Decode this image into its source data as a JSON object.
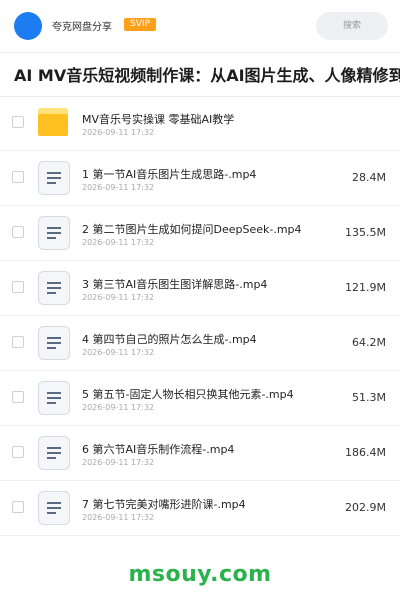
{
  "header": {
    "owner_name": "夸克网盘分享",
    "badge": "SVIP",
    "search_placeholder": "搜索",
    "colors": {
      "avatar": "#1e7cf2",
      "badge": "#ff9f1a"
    }
  },
  "share": {
    "title": "AI MV音乐短视频制作课：从AI图片生成、人像精修到导演"
  },
  "items": [
    {
      "type": "folder",
      "icon": "folder-icon",
      "name": "MV音乐号实操课 零基础AI教学",
      "date": "2026-09-11 17:32",
      "size": ""
    },
    {
      "type": "file",
      "icon": "file-icon",
      "name": "1 第一节AI音乐图片生成思路-.mp4",
      "date": "2026-09-11 17:32",
      "size": "28.4M"
    },
    {
      "type": "file",
      "icon": "file-icon",
      "name": "2 第二节图片生成如何提问DeepSeek-.mp4",
      "date": "2026-09-11 17:32",
      "size": "135.5M"
    },
    {
      "type": "file",
      "icon": "file-icon",
      "name": "3 第三节AI音乐图生图详解思路-.mp4",
      "date": "2026-09-11 17:32",
      "size": "121.9M"
    },
    {
      "type": "file",
      "icon": "file-icon",
      "name": "4 第四节自己的照片怎么生成-.mp4",
      "date": "2026-09-11 17:32",
      "size": "64.2M"
    },
    {
      "type": "file",
      "icon": "file-icon",
      "name": "5 第五节-固定人物长相只换其他元素-.mp4",
      "date": "2026-09-11 17:32",
      "size": "51.3M"
    },
    {
      "type": "file",
      "icon": "file-icon",
      "name": "6 第六节AI音乐制作流程-.mp4",
      "date": "2026-09-11 17:32",
      "size": "186.4M"
    },
    {
      "type": "file",
      "icon": "file-icon",
      "name": "7 第七节完美对嘴形进阶课-.mp4",
      "date": "2026-09-11 17:32",
      "size": "202.9M"
    }
  ],
  "watermark": {
    "text": "msouy.com",
    "color": "#2bb24c"
  }
}
